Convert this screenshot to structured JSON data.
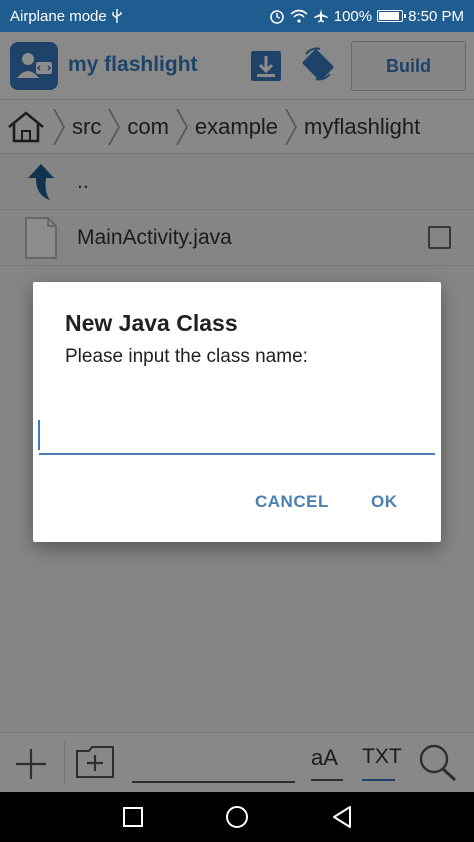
{
  "status_bar": {
    "left_text": "Airplane mode",
    "battery": "100%",
    "time": "8:50 PM"
  },
  "app_bar": {
    "title": "my flashlight",
    "build_label": "Build"
  },
  "breadcrumb": [
    "src",
    "com",
    "example",
    "myflashlight"
  ],
  "files": [
    {
      "name": "..",
      "kind": "parent"
    },
    {
      "name": "MainActivity.java",
      "kind": "file"
    }
  ],
  "dialog": {
    "title": "New Java Class",
    "message": "Please input the class name:",
    "input_value": "",
    "cancel_label": "CANCEL",
    "ok_label": "OK"
  },
  "bottom_bar": {
    "font_label": "aA",
    "txt_label": "TXT"
  },
  "colors": {
    "accent": "#3a7bbd",
    "status_bar": "#1f5d90",
    "dialog_button": "#4a7faf"
  }
}
